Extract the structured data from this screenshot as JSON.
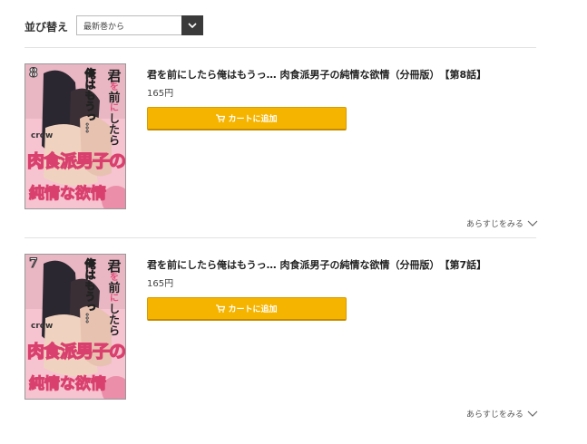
{
  "sort": {
    "label": "並び替え",
    "selected": "最新巻から"
  },
  "items": [
    {
      "cover_number": "8",
      "cover_title_chars": [
        "君",
        "を",
        "前",
        "に",
        "し",
        "た",
        "ら"
      ],
      "cover_subtitle": "俺はもうっ…",
      "cover_author": "crow",
      "cover_big": "肉食派男子の",
      "cover_bottom": "純情な欲情",
      "title": "君を前にしたら俺はもうっ… 肉食派男子の純情な欲情（分冊版）　【第8話】",
      "price": "165円",
      "cart_label": "カートに追加",
      "synopsis_label": "あらすじをみる"
    },
    {
      "cover_number": "7",
      "cover_title_chars": [
        "君",
        "を",
        "前",
        "に",
        "し",
        "た",
        "ら"
      ],
      "cover_subtitle": "俺はもうっ…",
      "cover_author": "crow",
      "cover_big": "肉食派男子の",
      "cover_bottom": "純情な欲情",
      "title": "君を前にしたら俺はもうっ… 肉食派男子の純情な欲情（分冊版）　【第7話】",
      "price": "165円",
      "cart_label": "カートに追加",
      "synopsis_label": "あらすじをみる"
    }
  ],
  "colors": {
    "cart_button": "#f5b400",
    "cover_pink": "#f7c9d6",
    "sort_arrow_bg": "#3a3a3a"
  },
  "icons": {
    "sort_arrow": "chevron-down-icon",
    "cart": "cart-icon",
    "synopsis": "chevron-down-icon"
  }
}
